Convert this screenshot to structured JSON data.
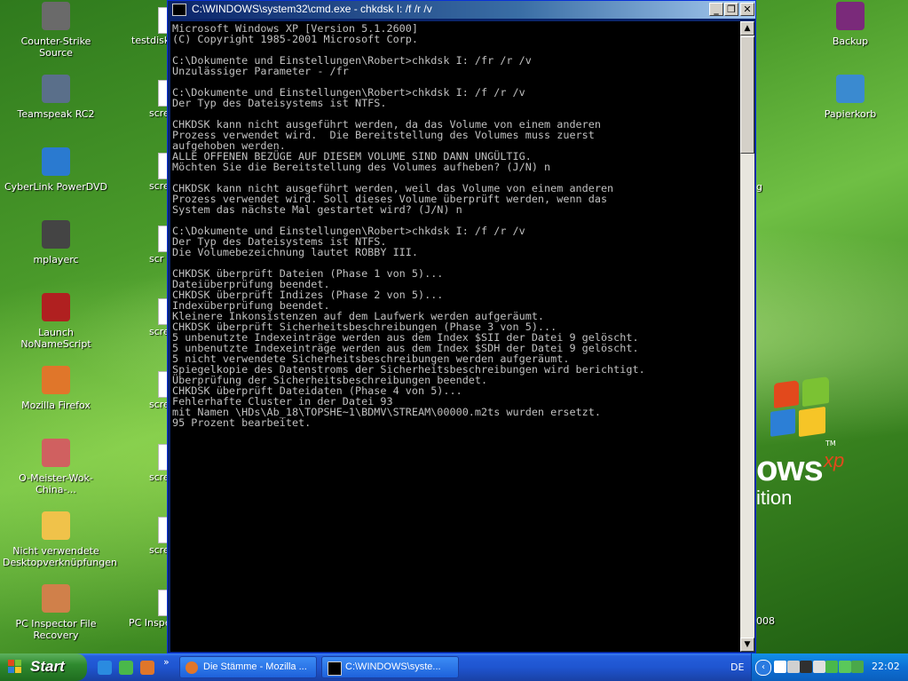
{
  "window": {
    "title": "C:\\WINDOWS\\system32\\cmd.exe - chkdsk I: /f /r /v",
    "console_text": "Microsoft Windows XP [Version 5.1.2600]\n(C) Copyright 1985-2001 Microsoft Corp.\n\nC:\\Dokumente und Einstellungen\\Robert>chkdsk I: /fr /r /v\nUnzulässiger Parameter - /fr\n\nC:\\Dokumente und Einstellungen\\Robert>chkdsk I: /f /r /v\nDer Typ des Dateisystems ist NTFS.\n\nCHKDSK kann nicht ausgeführt werden, da das Volume von einem anderen\nProzess verwendet wird.  Die Bereitstellung des Volumes muss zuerst\naufgehoben werden.\nALLE OFFENEN BEZÜGE AUF DIESEM VOLUME SIND DANN UNGÜLTIG.\nMöchten Sie die Bereitstellung des Volumes aufheben? (J/N) n\n\nCHKDSK kann nicht ausgeführt werden, weil das Volume von einem anderen\nProzess verwendet wird. Soll dieses Volume überprüft werden, wenn das\nSystem das nächste Mal gestartet wird? (J/N) n\n\nC:\\Dokumente und Einstellungen\\Robert>chkdsk I: /f /r /v\nDer Typ des Dateisystems ist NTFS.\nDie Volumebezeichnung lautet ROBBY III.\n\nCHKDSK überprüft Dateien (Phase 1 von 5)...\nDateiüberprüfung beendet.\nCHKDSK überprüft Indizes (Phase 2 von 5)...\nIndexüberprüfung beendet.\nKleinere Inkonsistenzen auf dem Laufwerk werden aufgeräumt.\nCHKDSK überprüft Sicherheitsbeschreibungen (Phase 3 von 5)...\n5 unbenutzte Indexeinträge werden aus dem Index $SII der Datei 9 gelöscht.\n5 unbenutzte Indexeinträge werden aus dem Index $SDH der Datei 9 gelöscht.\n5 nicht verwendete Sicherheitsbeschreibungen werden aufgeräumt.\nSpiegelkopie des Datenstroms der Sicherheitsbeschreibungen wird berichtigt.\nÜberprüfung der Sicherheitsbeschreibungen beendet.\nCHKDSK überprüft Dateidaten (Phase 4 von 5)...\nFehlerhafte Cluster in der Datei 93\nmit Namen \\HDs\\Ab_18\\TOPSHE~1\\BDMV\\STREAM\\00000.m2ts wurden ersetzt.\n95 Prozent bearbeitet.",
    "minimize_icon": "minimize-icon",
    "maximize_icon": "restore-icon",
    "close_icon": "close-icon"
  },
  "desktop_icons_left": [
    {
      "label": "Counter-Strike Source",
      "icon": "counter-strike-icon",
      "color": "#6a6a6a"
    },
    {
      "label": "Teamspeak RC2",
      "icon": "teamspeak-icon",
      "color": "#5a6f8a"
    },
    {
      "label": "CyberLink PowerDVD",
      "icon": "powerdvd-icon",
      "color": "#2a7ad0"
    },
    {
      "label": "mplayerc",
      "icon": "mplayer-icon",
      "color": "#444444"
    },
    {
      "label": "Launch NoNameScript",
      "icon": "script-icon",
      "color": "#b02020"
    },
    {
      "label": "Mozilla Firefox",
      "icon": "firefox-icon",
      "color": "#e0762a"
    },
    {
      "label": "O-Meister-Wok-China-...",
      "icon": "document-icon",
      "color": "#d06060"
    },
    {
      "label": "Nicht verwendete Desktopverknüpfungen",
      "icon": "folder-icon",
      "color": "#f0c24a"
    },
    {
      "label": "PC Inspector File Recovery",
      "icon": "pc-inspector-icon",
      "color": "#d0804a"
    }
  ],
  "desktop_icons_partial": [
    {
      "label": "testdisk",
      "icon": "folder-icon"
    },
    {
      "label": "scree",
      "icon": "screenshot-icon"
    },
    {
      "label": "scree",
      "icon": "screenshot-icon"
    },
    {
      "label": "scr",
      "icon": "screenshot-icon"
    },
    {
      "label": "scre",
      "icon": "screenshot-icon"
    },
    {
      "label": "scre",
      "icon": "screenshot-icon"
    },
    {
      "label": "scre",
      "icon": "screenshot-icon"
    },
    {
      "label": "scre",
      "icon": "screenshot-icon"
    },
    {
      "label": "PC Inspe reco",
      "icon": "pc-inspector-icon"
    }
  ],
  "desktop_icons_right": [
    {
      "label": "Backup",
      "icon": "winrar-icon",
      "color": "#7a2a7a"
    },
    {
      "label": "Papierkorb",
      "icon": "recycle-bin-icon",
      "color": "#3a8ad0"
    }
  ],
  "wallpaper_fragments": {
    "logo_text": "ows",
    "xp_text": "xp",
    "edition_text": "ition",
    "tm_text": "TM",
    "year_text": "008",
    "side_letter": "g"
  },
  "taskbar": {
    "start_label": "Start",
    "quicklaunch": [
      {
        "icon": "ie-icon",
        "color": "#2a8be0"
      },
      {
        "icon": "messenger-icon",
        "color": "#4ab84a"
      },
      {
        "icon": "firefox-icon",
        "color": "#e0762a"
      }
    ],
    "overflow": "»",
    "tasks": [
      {
        "label": "Die Stämme - Mozilla ...",
        "icon": "firefox-icon",
        "color": "#e0762a"
      },
      {
        "label": "C:\\WINDOWS\\syste...",
        "icon": "cmd-icon",
        "color": "#000000"
      }
    ],
    "language": "DE",
    "tray_chevron": "chevron-left-icon",
    "tray_icons": [
      "network-icon",
      "volume-icon",
      "steam-icon",
      "program-icon",
      "user-icon",
      "gear-icon",
      "update-icon"
    ],
    "clock": "22:02"
  }
}
